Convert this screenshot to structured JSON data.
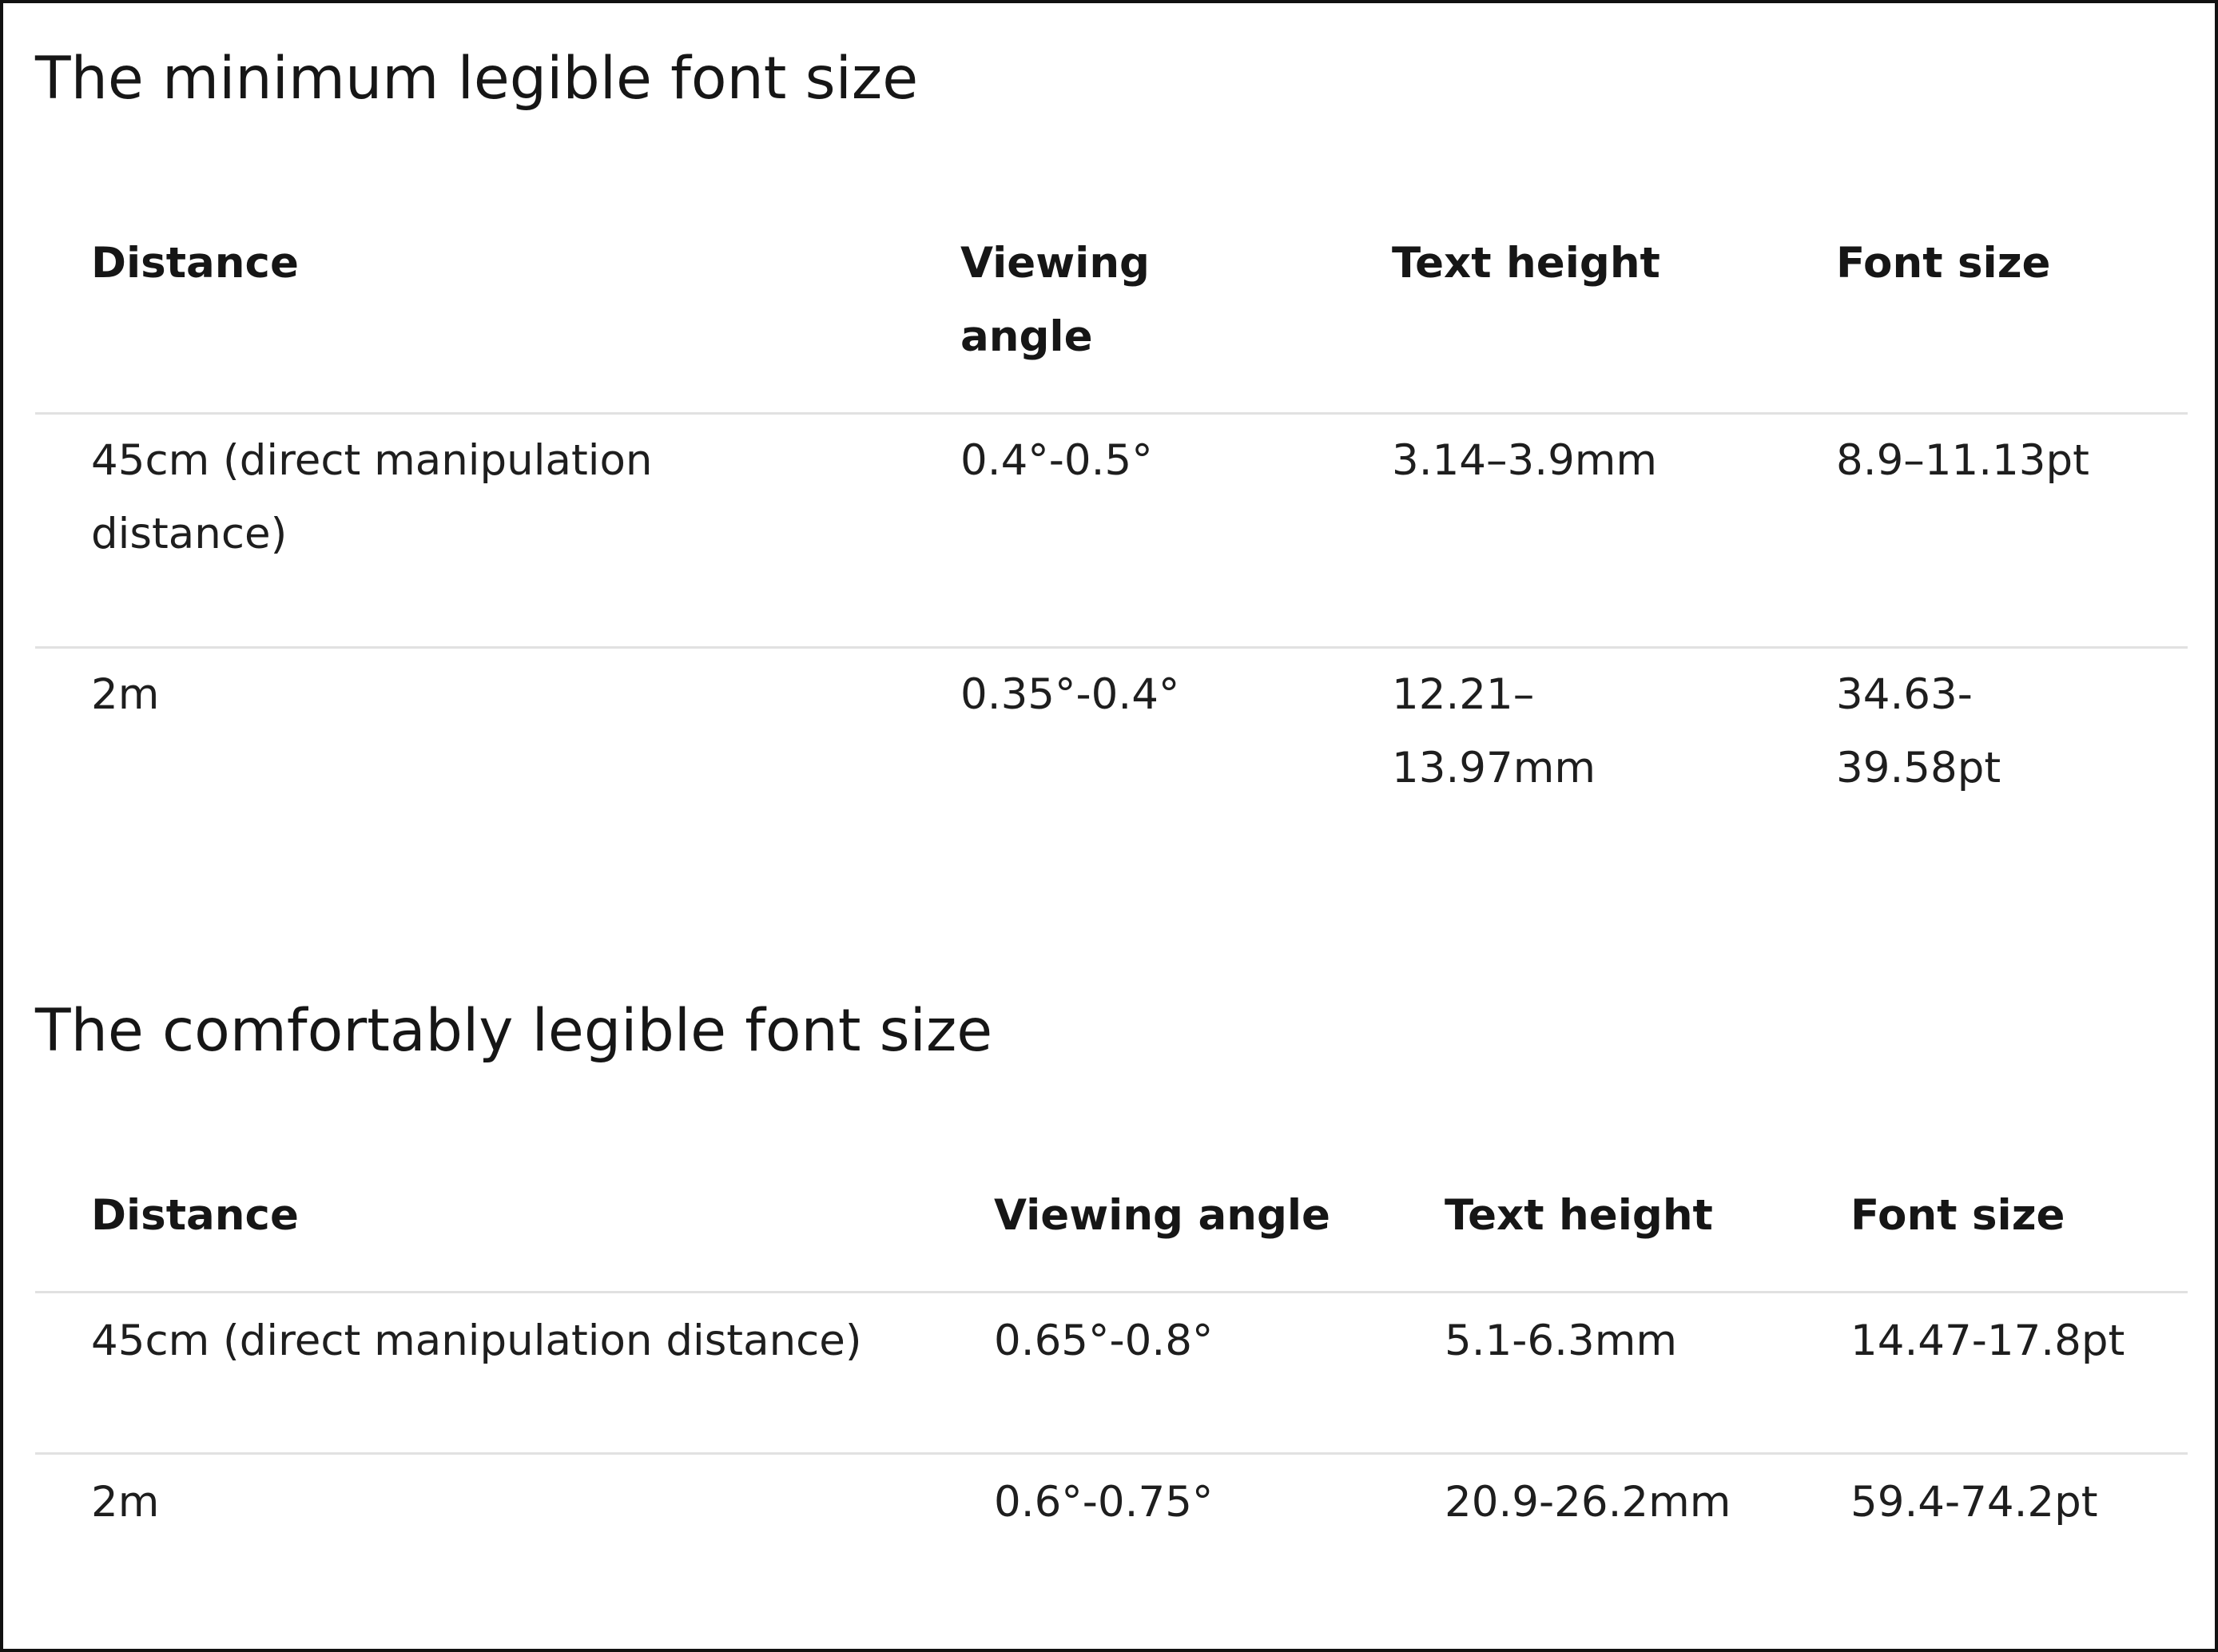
{
  "sections": [
    {
      "title": "The minimum legible font size",
      "headers": [
        "Distance",
        "Viewing angle",
        "Text height",
        "Font size"
      ],
      "rows": [
        [
          "45cm (direct manipulation distance)",
          "0.4°-0.5°",
          "3.14–3.9mm",
          "8.9–11.13pt"
        ],
        [
          "2m",
          "0.35°-0.4°",
          "12.21–13.97mm",
          "34.63-39.58pt"
        ]
      ]
    },
    {
      "title": "The comfortably legible font size",
      "headers": [
        "Distance",
        "Viewing angle",
        "Text height",
        "Font size"
      ],
      "rows": [
        [
          "45cm (direct manipulation distance)",
          "0.65°-0.8°",
          "5.1-6.3mm",
          "14.47-17.8pt"
        ],
        [
          "2m",
          "0.6°-0.75°",
          "20.9-26.2mm",
          "59.4-74.2pt"
        ]
      ]
    }
  ]
}
